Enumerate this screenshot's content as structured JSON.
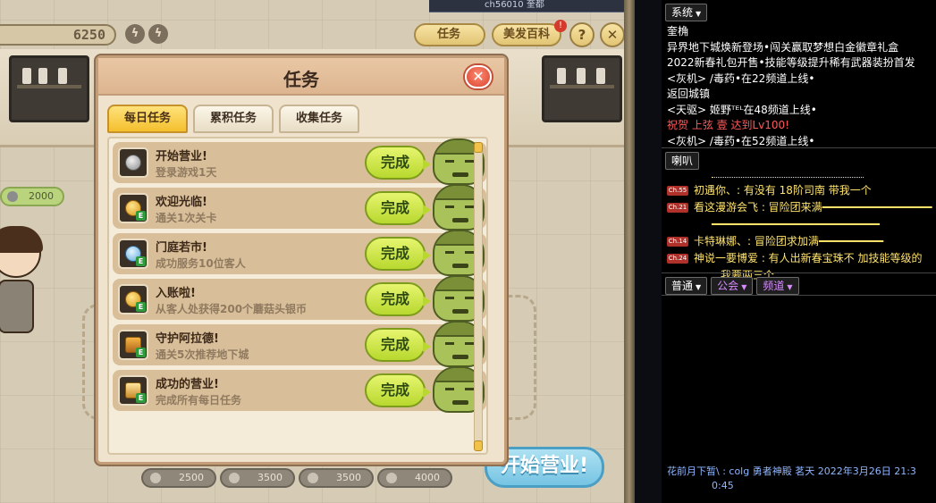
{
  "game": {
    "coins": "6250",
    "top_buttons": {
      "task": "任务",
      "hair_encyclopedia": "美发百科",
      "badge": "!",
      "help": "?",
      "close": "✕"
    },
    "side_coin": "2000",
    "bottom_coins": [
      "2500",
      "3500",
      "3500",
      "4000"
    ],
    "start_button": "开始营业!",
    "top_strip_text": "ch56010 奎都"
  },
  "dialog": {
    "title": "任务",
    "close": "✕",
    "tabs": [
      "每日任务",
      "累积任务",
      "收集任务"
    ],
    "active_tab": 0,
    "tasks": [
      {
        "name": "开始营业!",
        "desc": "登录游戏1天",
        "button": "完成",
        "icon": "silver-coin-icon"
      },
      {
        "name": "欢迎光临!",
        "desc": "通关1次关卡",
        "button": "完成",
        "icon": "gold-coin-icon"
      },
      {
        "name": "门庭若市!",
        "desc": "成功服务10位客人",
        "button": "完成",
        "icon": "crystal-icon"
      },
      {
        "name": "入账啦!",
        "desc": "从客人处获得200个蘑菇头银币",
        "button": "完成",
        "icon": "gold-coin-icon"
      },
      {
        "name": "守护阿拉德!",
        "desc": "通关5次推荐地下城",
        "button": "完成",
        "icon": "chest-icon"
      },
      {
        "name": "成功的营业!",
        "desc": "完成所有每日任务",
        "button": "完成",
        "icon": "gold-book-icon"
      }
    ]
  },
  "chat": {
    "system_tab": "系统",
    "system_lines": [
      {
        "text": "奎桷",
        "color": "#ffffff"
      },
      {
        "text": "异界地下城焕新登场•闯关赢取梦想白金徽章礼盒",
        "color": "#ffffff"
      },
      {
        "text": "2022新春礼包开售•技能等级提升稀有武器装扮首发",
        "color": "#ffffff"
      },
      {
        "text": "<灰机> /毒药•在22频道上线•",
        "color": "#ffffff"
      },
      {
        "text": "返回城镇",
        "color": "#ffffff"
      },
      {
        "text": "<天驱> 姬野ᵀᴱᴸ在48频道上线•",
        "color": "#ffffff"
      },
      {
        "text": "祝贺 上弦 壹 达到Lv100!",
        "color": "#ff5a5a"
      },
      {
        "text": "<灰机> /毒药•在52频道上线•",
        "color": "#ffffff"
      }
    ],
    "horn_tab": "喇叭",
    "horn_lines": [
      {
        "channel": "Ch.55",
        "text": "初遇你、: 有没有   18阶司南      带我一个",
        "color": "#ffe36b"
      },
      {
        "channel": "Ch.21",
        "text": "看这漫游会飞 : 冒险团来满━━━━━━━━━━━━━━━━━",
        "color": "#ffe36b"
      },
      {
        "channel": "",
        "text": "━━━━━━━━━━━━━━━━━━━━━━━━━━",
        "color": "#ffe36b"
      },
      {
        "channel": "Ch.14",
        "text": "卡特琳娜、: 冒险团求加满━━━━━━━━━━",
        "color": "#ffe36b"
      },
      {
        "channel": "Ch.24",
        "text": "神说一要博爱 : 有人出新春宝珠不    加技能等级的",
        "color": "#ffe36b"
      },
      {
        "channel": "",
        "text": "我要两三个",
        "color": "#ffe36b"
      }
    ],
    "bottom_tabs": [
      {
        "label": "普通",
        "color": "#ffffff"
      },
      {
        "label": "公会",
        "color": "#d88cff"
      },
      {
        "label": "频道",
        "color": "#d88cff"
      }
    ],
    "footer_line1": "花前月下暂\\ : colg  勇者神殿  茗天   2022年3月26日 21:3",
    "footer_line2": "0:45"
  }
}
